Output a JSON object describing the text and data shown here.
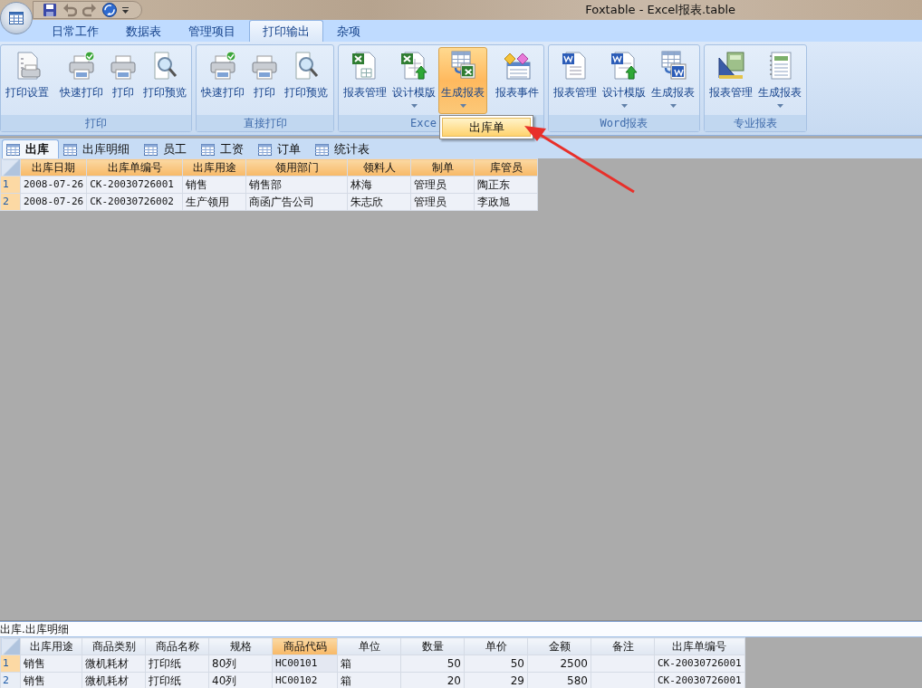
{
  "window": {
    "title": "Foxtable - Excel报表.table"
  },
  "ribbon_tabs": [
    {
      "label": "日常工作",
      "selected": false
    },
    {
      "label": "数据表",
      "selected": false
    },
    {
      "label": "管理项目",
      "selected": false
    },
    {
      "label": "打印输出",
      "selected": true
    },
    {
      "label": "杂项",
      "selected": false
    }
  ],
  "ribbon_groups": [
    {
      "label": "打印",
      "buttons": [
        {
          "kind": "button",
          "label": "打印设置",
          "dropdown": false,
          "selected": false
        },
        {
          "kind": "separator"
        },
        {
          "kind": "button",
          "label": "快速打印",
          "dropdown": false,
          "selected": false
        },
        {
          "kind": "button",
          "label": "打印",
          "dropdown": false,
          "selected": false
        },
        {
          "kind": "button",
          "label": "打印预览",
          "dropdown": false,
          "selected": false
        }
      ]
    },
    {
      "label": "直接打印",
      "buttons": [
        {
          "kind": "button",
          "label": "快速打印",
          "dropdown": false,
          "selected": false
        },
        {
          "kind": "button",
          "label": "打印",
          "dropdown": false,
          "selected": false
        },
        {
          "kind": "button",
          "label": "打印预览",
          "dropdown": false,
          "selected": false
        }
      ]
    },
    {
      "label": "Exce",
      "buttons": [
        {
          "kind": "button",
          "label": "报表管理",
          "dropdown": false,
          "selected": false
        },
        {
          "kind": "button",
          "label": "设计模版",
          "dropdown": true,
          "selected": false
        },
        {
          "kind": "button",
          "label": "生成报表",
          "dropdown": true,
          "selected": true
        },
        {
          "kind": "separator"
        },
        {
          "kind": "button",
          "label": "报表事件",
          "dropdown": false,
          "selected": false
        }
      ]
    },
    {
      "label": "Word报表",
      "buttons": [
        {
          "kind": "button",
          "label": "报表管理",
          "dropdown": false,
          "selected": false
        },
        {
          "kind": "button",
          "label": "设计模版",
          "dropdown": true,
          "selected": false
        },
        {
          "kind": "button",
          "label": "生成报表",
          "dropdown": true,
          "selected": false
        }
      ]
    },
    {
      "label": "专业报表",
      "buttons": [
        {
          "kind": "button",
          "label": "报表管理",
          "dropdown": false,
          "selected": false
        },
        {
          "kind": "button",
          "label": "生成报表",
          "dropdown": true,
          "selected": false
        }
      ]
    }
  ],
  "dropdown_menu": {
    "items": [
      {
        "label": "出库单",
        "selected": true
      }
    ]
  },
  "sheet_tabs": [
    {
      "label": "出库",
      "selected": true
    },
    {
      "label": "出库明细",
      "selected": false
    },
    {
      "label": "员工",
      "selected": false
    },
    {
      "label": "工资",
      "selected": false
    },
    {
      "label": "订单",
      "selected": false
    },
    {
      "label": "统计表",
      "selected": false
    }
  ],
  "main_table": {
    "columns": [
      {
        "label": "出库日期",
        "selected": true,
        "numeric": false
      },
      {
        "label": "出库单编号",
        "selected": true,
        "numeric": false
      },
      {
        "label": "出库用途",
        "selected": true,
        "numeric": false
      },
      {
        "label": "领用部门",
        "selected": true,
        "numeric": false
      },
      {
        "label": "领料人",
        "selected": true,
        "numeric": false
      },
      {
        "label": "制单",
        "selected": true,
        "numeric": false
      },
      {
        "label": "库管员",
        "selected": true,
        "numeric": false
      }
    ],
    "rows": [
      {
        "number": "1",
        "selected": true,
        "current": false,
        "cells": [
          "2008-07-26",
          "CK-20030726001",
          "销售",
          "销售部",
          "林海",
          "管理员",
          "陶正东"
        ]
      },
      {
        "number": "2",
        "selected": true,
        "current": false,
        "cells": [
          "2008-07-26",
          "CK-20030726002",
          "生产领用",
          "商函广告公司",
          "朱志欣",
          "管理员",
          "李政旭"
        ]
      }
    ]
  },
  "detail_panel": {
    "title": "出库.出库明细",
    "table": {
      "columns": [
        {
          "label": "出库用途",
          "selected": false,
          "numeric": false
        },
        {
          "label": "商品类别",
          "selected": false,
          "numeric": false
        },
        {
          "label": "商品名称",
          "selected": false,
          "numeric": false
        },
        {
          "label": "规格",
          "selected": false,
          "numeric": false
        },
        {
          "label": "商品代码",
          "selected": true,
          "numeric": false
        },
        {
          "label": "单位",
          "selected": false,
          "numeric": false
        },
        {
          "label": "数量",
          "selected": false,
          "numeric": true
        },
        {
          "label": "单价",
          "selected": false,
          "numeric": true
        },
        {
          "label": "金额",
          "selected": false,
          "numeric": true
        },
        {
          "label": "备注",
          "selected": false
        },
        {
          "label": "出库单编号",
          "selected": false
        }
      ],
      "rows": [
        {
          "number": "1",
          "selected": true,
          "current": true,
          "cells": [
            "销售",
            "微机耗材",
            "打印纸",
            "80列",
            "HC00101",
            "箱",
            "50",
            "50",
            "2500",
            "",
            "CK-20030726001"
          ]
        },
        {
          "number": "2",
          "selected": false,
          "current": false,
          "cells": [
            "销售",
            "微机耗材",
            "打印纸",
            "40列",
            "HC00102",
            "箱",
            "20",
            "29",
            "580",
            "",
            "CK-20030726001"
          ]
        }
      ]
    }
  }
}
